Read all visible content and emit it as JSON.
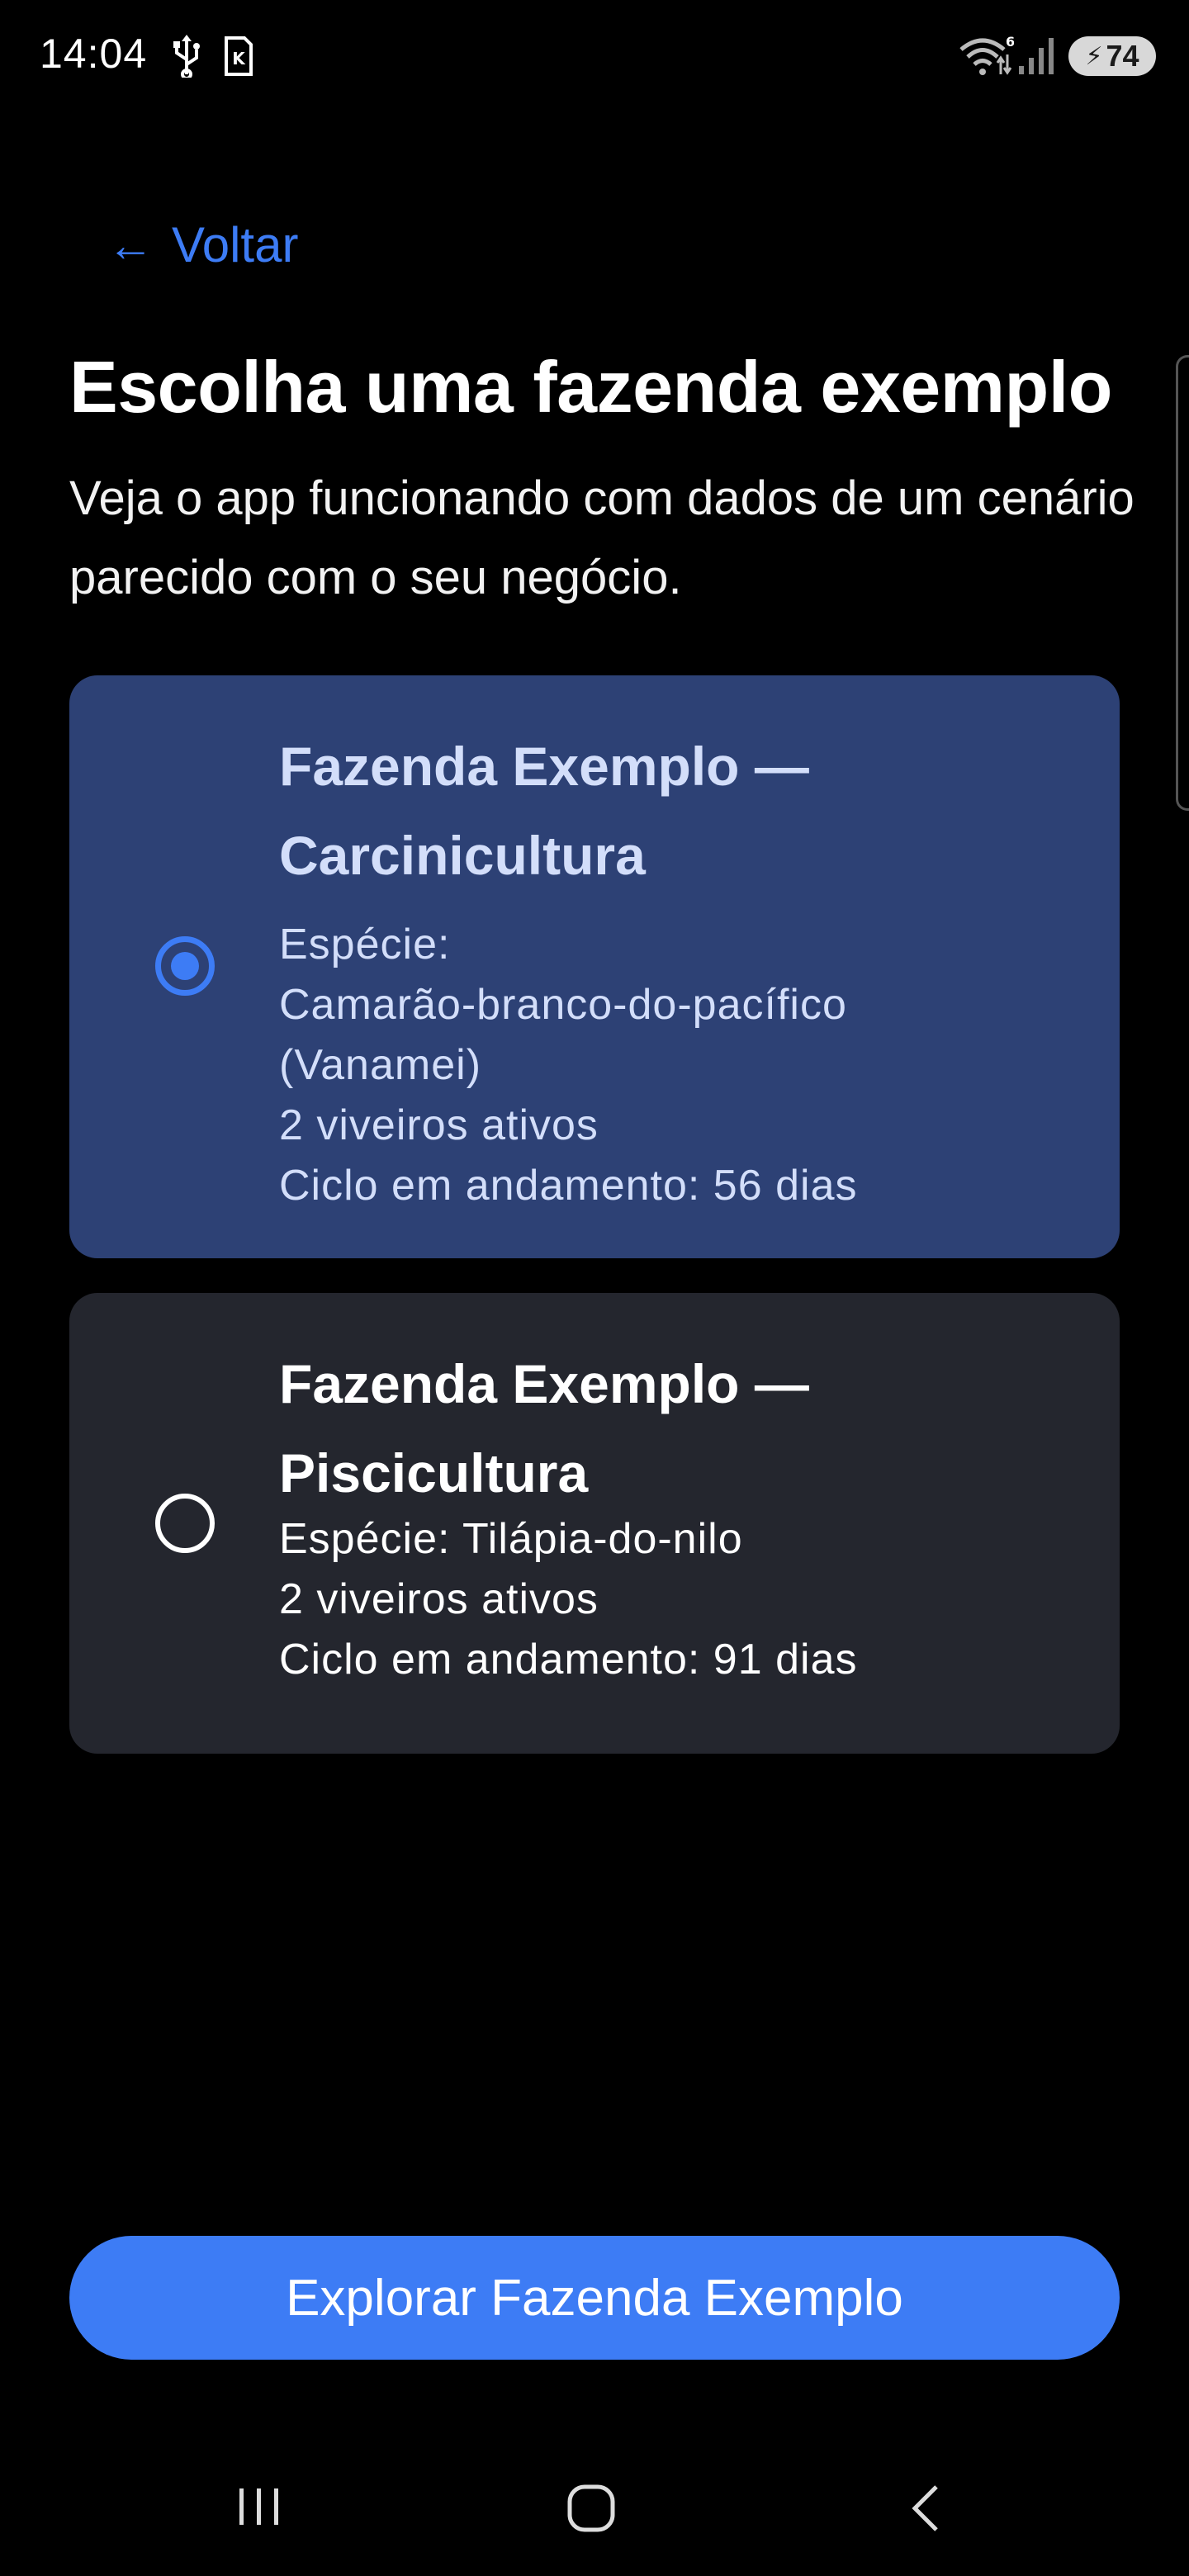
{
  "status_bar": {
    "time": "14:04",
    "battery_level": "74",
    "icons": [
      "usb-icon",
      "sim-card-icon",
      "wifi-icon",
      "signal-icon",
      "battery-icon"
    ]
  },
  "back": {
    "arrow": "←",
    "label": "Voltar"
  },
  "header": {
    "title": "Escolha uma fazenda exemplo",
    "subtitle": "Veja o app funcionando com dados de um cenário parecido com o seu negócio."
  },
  "farms": [
    {
      "title": "Fazenda Exemplo — Carcinicultura",
      "species": "Espécie:\nCamarão-branco-do-pacífico\n(Vanamei)",
      "ponds": "2 viveiros ativos",
      "cycle": "Ciclo em andamento: 56 dias",
      "selected": true
    },
    {
      "title": "Fazenda Exemplo — Piscicultura",
      "species": "Espécie: Tilápia-do-nilo",
      "ponds": "2 viveiros ativos",
      "cycle": "Ciclo em andamento: 91 dias",
      "selected": false
    }
  ],
  "primary_action": {
    "label": "Explorar Fazenda Exemplo"
  },
  "colors": {
    "accent": "#3d7cf5",
    "selected_card": "#2d4175",
    "unselected_card": "#24262e",
    "background": "#000000"
  },
  "nav_bar": {
    "icons": [
      "recent-apps-icon",
      "home-icon",
      "back-icon"
    ]
  }
}
